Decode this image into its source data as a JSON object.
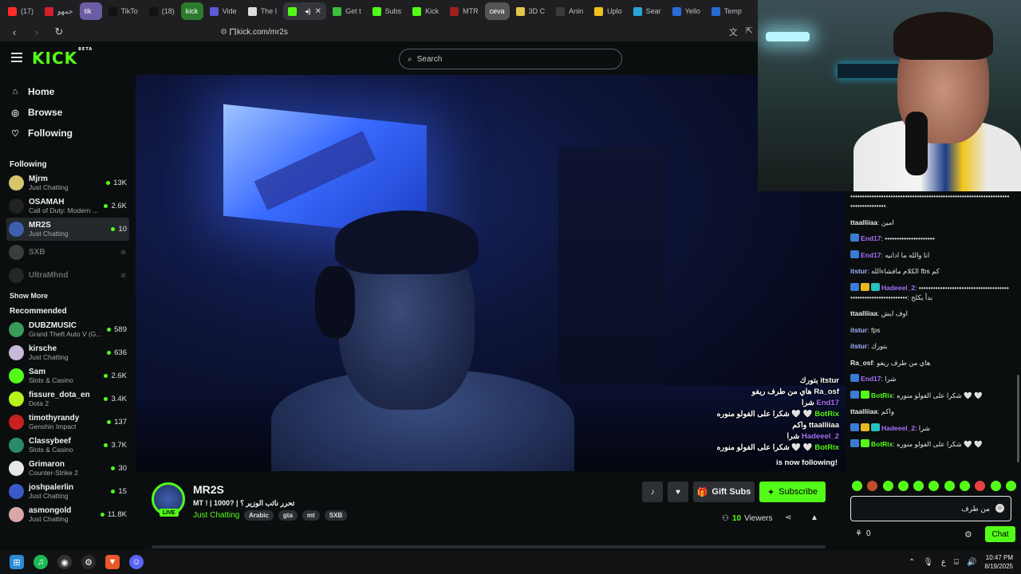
{
  "browser": {
    "tabs": [
      {
        "label": "(17)",
        "fav": "#ff2b2b"
      },
      {
        "label": "جمهو",
        "fav": "#d61f2c"
      },
      {
        "label": "tik",
        "fav": "#6b5ca5",
        "plain": true
      },
      {
        "label": "TikTo",
        "fav": "#111111"
      },
      {
        "label": "(18)",
        "fav": "#111111"
      },
      {
        "label": "kick",
        "fav": "#2c7a2c",
        "plain": true
      },
      {
        "label": "Vide",
        "fav": "#5b5bd6"
      },
      {
        "label": "The I",
        "fav": "#dddddd"
      },
      {
        "label": "",
        "fav": "#53fc18",
        "active": true,
        "audio": true
      },
      {
        "label": "Get t",
        "fav": "#3bbf3b"
      },
      {
        "label": "Subs",
        "fav": "#53fc18"
      },
      {
        "label": "Kick",
        "fav": "#53fc18"
      },
      {
        "label": "MTR",
        "fav": "#a02020"
      },
      {
        "label": "ceva",
        "fav": "#555555",
        "plain": true
      },
      {
        "label": "3D C",
        "fav": "#e3c54a"
      },
      {
        "label": "Anin",
        "fav": "#3a3a3a"
      },
      {
        "label": "Uplo",
        "fav": "#f0c020"
      },
      {
        "label": "Sear",
        "fav": "#2aa4d6"
      },
      {
        "label": "Yello",
        "fav": "#2a6ad6"
      },
      {
        "label": "Temp",
        "fav": "#2a6ad6"
      }
    ],
    "url": "kick.com/mr2s"
  },
  "header": {
    "logo": "KICK",
    "logo_sup": "BETA",
    "search_placeholder": "Search"
  },
  "sidebar": {
    "nav": [
      {
        "label": "Home",
        "icon": "home-icon",
        "glyph": "⌂"
      },
      {
        "label": "Browse",
        "icon": "browse-icon",
        "glyph": "◎"
      },
      {
        "label": "Following",
        "icon": "heart-icon",
        "glyph": "♡"
      }
    ],
    "following_title": "Following",
    "following": [
      {
        "name": "Mjrm",
        "category": "Just Chatting",
        "viewers": "13K",
        "color": "#d6c56a"
      },
      {
        "name": "OSAMAH",
        "category": "Call of Duty: Modern ...",
        "viewers": "2.6K",
        "color": "#222222"
      },
      {
        "name": "MR2S",
        "category": "Just Chatting",
        "viewers": "10",
        "color": "#3e5fae",
        "selected": true
      },
      {
        "name": "SXB",
        "category": "",
        "viewers": "",
        "color": "#777777",
        "offline": true
      },
      {
        "name": "UltraMhnd",
        "category": "",
        "viewers": "",
        "color": "#444444",
        "offline": true
      }
    ],
    "show_more": "Show More",
    "recommended_title": "Recommended",
    "recommended": [
      {
        "name": "DUBZMUSIC",
        "category": "Grand Theft Auto V (G...",
        "viewers": "589",
        "color": "#3a9a5a"
      },
      {
        "name": "kirsche",
        "category": "Just Chatting",
        "viewers": "636",
        "color": "#c9b8d8"
      },
      {
        "name": "Sam",
        "category": "Slots & Casino",
        "viewers": "2.6K",
        "color": "#53fc18"
      },
      {
        "name": "fissure_dota_en",
        "category": "Dota 2",
        "viewers": "3.4K",
        "color": "#b6f21c"
      },
      {
        "name": "timothyrandy",
        "category": "Genshin Impact",
        "viewers": "137",
        "color": "#c92020"
      },
      {
        "name": "Classybeef",
        "category": "Slots & Casino",
        "viewers": "3.7K",
        "color": "#2a8a6a"
      },
      {
        "name": "Grimaron",
        "category": "Counter-Strike 2",
        "viewers": "30",
        "color": "#e8e8e8"
      },
      {
        "name": "joshpalerlin",
        "category": "Just Chatting",
        "viewers": "15",
        "color": "#3a5ac8"
      },
      {
        "name": "asmongold",
        "category": "Just Chatting",
        "viewers": "11.8K",
        "color": "#d8a8a8"
      }
    ]
  },
  "overlay": {
    "lines": [
      {
        "user": "itstur",
        "text": "بتورك",
        "color": "#ffffff"
      },
      {
        "user": "Ra_osf",
        "text": "هاي من طرف ريفو",
        "color": "#ffffff"
      },
      {
        "user": "End17",
        "text": "شرا",
        "color": "#a970ff"
      },
      {
        "user": "BotRix",
        "text": "شكرا على الفولو منوره 🤍 🤍",
        "color": "#53fc18"
      },
      {
        "user": "ttaalliiaa",
        "text": "واكم",
        "color": "#ffffff"
      },
      {
        "user": "Hadeeel_2",
        "text": "شرا",
        "color": "#a970ff"
      },
      {
        "user": "BotRix",
        "text": "شكرا على الفولو منوره 🤍 🤍",
        "color": "#53fc18"
      }
    ],
    "follow_text": "is now following!"
  },
  "stream": {
    "name": "MR2S",
    "live": "LIVE",
    "title": "MT ! | 1000? | تحرر نائب الوزير ؟",
    "category": "Just Chatting",
    "tags": [
      "Arabic",
      "gta",
      "mt",
      "SXB"
    ],
    "gift_label": "Gift Subs",
    "subscribe_label": "Subscribe",
    "viewers_count": "10",
    "viewers_label": "Viewers"
  },
  "chat": {
    "messages": [
      {
        "user": "",
        "text": "••••••••••••••••••••••••••••••••••••••••••••••••••••••••••••••••••••••••••••••••••",
        "color": "#ffffff"
      },
      {
        "user": "ttaalliiaa",
        "text": "امين",
        "color": "#e8e8e8"
      },
      {
        "user": "End17",
        "text": "•••••••••••••••••••••",
        "color": "#a970ff",
        "badges": [
          "#3a7bd5"
        ]
      },
      {
        "user": "End17",
        "text": "انا والله ما ادانيه",
        "color": "#a970ff",
        "badges": [
          "#3a7bd5"
        ]
      },
      {
        "user": "itstur",
        "text": "الكلام مافشاءالله fbs كم",
        "color": "#9fb6ff"
      },
      {
        "user": "Hadeeel_2",
        "text": "••••••••••••••••••••••••••••••••••••••••••••••••••••••••••••••: بدأ يكلح",
        "color": "#a970ff",
        "badges": [
          "#3a7bd5",
          "#e8b820",
          "#28c0c0"
        ]
      },
      {
        "user": "ttaalliiaa",
        "text": "اوف ايش",
        "color": "#e8e8e8"
      },
      {
        "user": "itstur",
        "text": "fps",
        "color": "#9fb6ff"
      },
      {
        "user": "itstur",
        "text": "بتورك",
        "color": "#9fb6ff"
      },
      {
        "user": "Ra_osf",
        "text": "هاي من طرف ريفو",
        "color": "#e8e8e8"
      },
      {
        "user": "End17",
        "text": "شرا",
        "color": "#a970ff",
        "badges": [
          "#3a7bd5"
        ]
      },
      {
        "user": "BotRix",
        "text": "شكرا على الفولو منوره 🤍 🤍",
        "color": "#53fc18",
        "badges": [
          "#3a7bd5",
          "#53fc18"
        ]
      },
      {
        "user": "ttaalliiaa",
        "text": "واكم",
        "color": "#e8e8e8"
      },
      {
        "user": "Hadeeel_2",
        "text": "شرا",
        "color": "#a970ff",
        "badges": [
          "#3a7bd5",
          "#e8b820",
          "#28c0c0"
        ]
      },
      {
        "user": "BotRix",
        "text": "شكرا على الفولو منوره 🤍 🤍",
        "color": "#53fc18",
        "badges": [
          "#3a7bd5",
          "#53fc18"
        ]
      }
    ],
    "emotes": [
      "#53fc18",
      "#c0502a",
      "#53fc18",
      "#53fc18",
      "#53fc18",
      "#53fc18",
      "#53fc18",
      "#53fc18",
      "#e84040",
      "#53fc18",
      "#53fc18"
    ],
    "input_value": "من طرف",
    "points": "0",
    "send_label": "Chat"
  },
  "taskbar": {
    "time": "10:47 PM",
    "date": "8/19/2025",
    "lang": "ع"
  }
}
